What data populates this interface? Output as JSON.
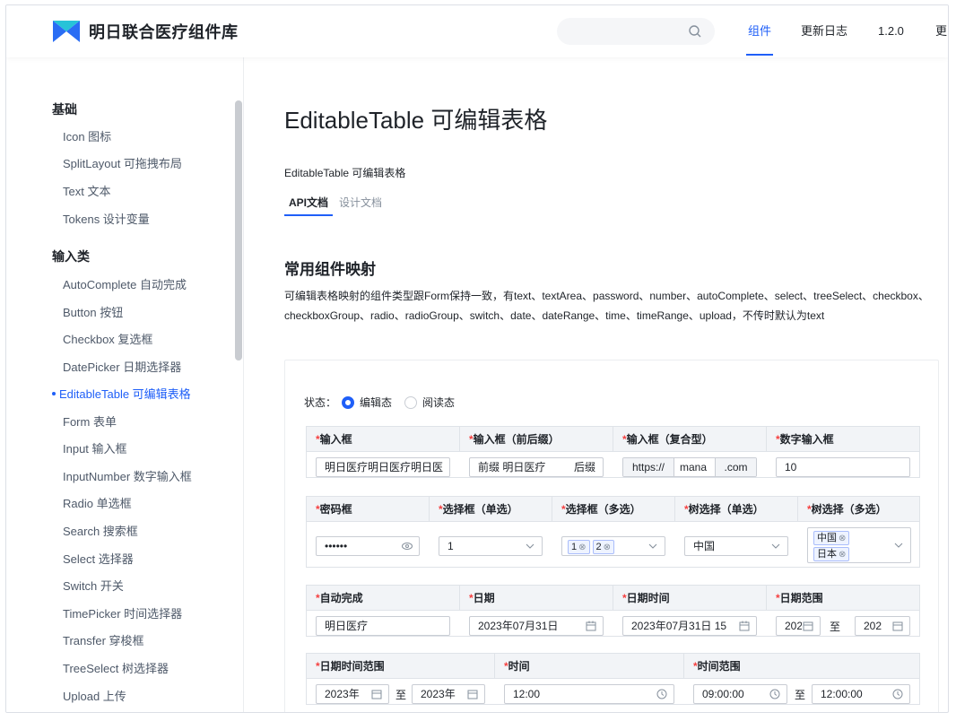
{
  "header": {
    "brand": "明日联合医疗组件库",
    "nav": [
      "组件",
      "更新日志",
      "1.2.0",
      "更"
    ]
  },
  "sidebar": {
    "group1": "基础",
    "items1": [
      "Icon 图标",
      "SplitLayout 可拖拽布局",
      "Text 文本",
      "Tokens 设计变量"
    ],
    "group2": "输入类",
    "items2": [
      "AutoComplete 自动完成",
      "Button 按钮",
      "Checkbox 复选框",
      "DatePicker 日期选择器",
      "EditableTable 可编辑表格",
      "Form 表单",
      "Input 输入框",
      "InputNumber 数字输入框",
      "Radio 单选框",
      "Search 搜索框",
      "Select 选择器",
      "Switch 开关",
      "TimePicker 时间选择器",
      "Transfer 穿梭框",
      "TreeSelect 树选择器",
      "Upload 上传"
    ]
  },
  "main": {
    "title": "EditableTable 可编辑表格",
    "subtitle": "EditableTable 可编辑表格",
    "tabs": [
      "API文档",
      "设计文档"
    ],
    "section_title": "常用组件映射",
    "section_desc": "可编辑表格映射的组件类型跟Form保持一致，有text、textArea、password、number、autoComplete、select、treeSelect、checkbox、checkboxGroup、radio、radioGroup、switch、date、dateRange、time、timeRange、upload，不传时默认为text"
  },
  "demo": {
    "state_label": "状态：",
    "state_edit": "编辑态",
    "state_read": "阅读态",
    "t1": {
      "headers": [
        "输入框",
        "输入框（前后缀）",
        "输入框（复合型）",
        "数字输入框"
      ],
      "input_value": "明日医疗明日医疗明日医",
      "prefix": "前缀",
      "prefix_value": "明日医疗",
      "suffix": "后缀",
      "addon_before": "https://",
      "addon_value": "mana",
      "addon_after": ".com",
      "number_value": "10"
    },
    "t2": {
      "headers": [
        "密码框",
        "选择框（单选）",
        "选择框（多选）",
        "树选择（单选）",
        "树选择（多选）"
      ],
      "password_value": "••••••",
      "select_value": "1",
      "multi_tags": [
        "1",
        "2"
      ],
      "tree_value": "中国",
      "tree_tags": [
        "中国",
        "日本"
      ]
    },
    "t3": {
      "headers": [
        "自动完成",
        "日期",
        "日期时间",
        "日期范围"
      ],
      "auto_value": "明日医疗",
      "date_value": "2023年07月31日",
      "datetime_value": "2023年07月31日 15",
      "range_start": "202",
      "range_sep": "至",
      "range_end": "202"
    },
    "t4": {
      "headers": [
        "日期时间范围",
        "时间",
        "时间范围"
      ],
      "dtr_start": "2023年",
      "dtr_sep": "至",
      "dtr_end": "2023年",
      "time_value": "12:00",
      "tr_start": "09:00:00",
      "tr_sep": "至",
      "tr_end": "12:00:00"
    },
    "required_mark": "*"
  },
  "colors": {
    "accent": "#1f5ff8",
    "required": "#f53f3f"
  }
}
